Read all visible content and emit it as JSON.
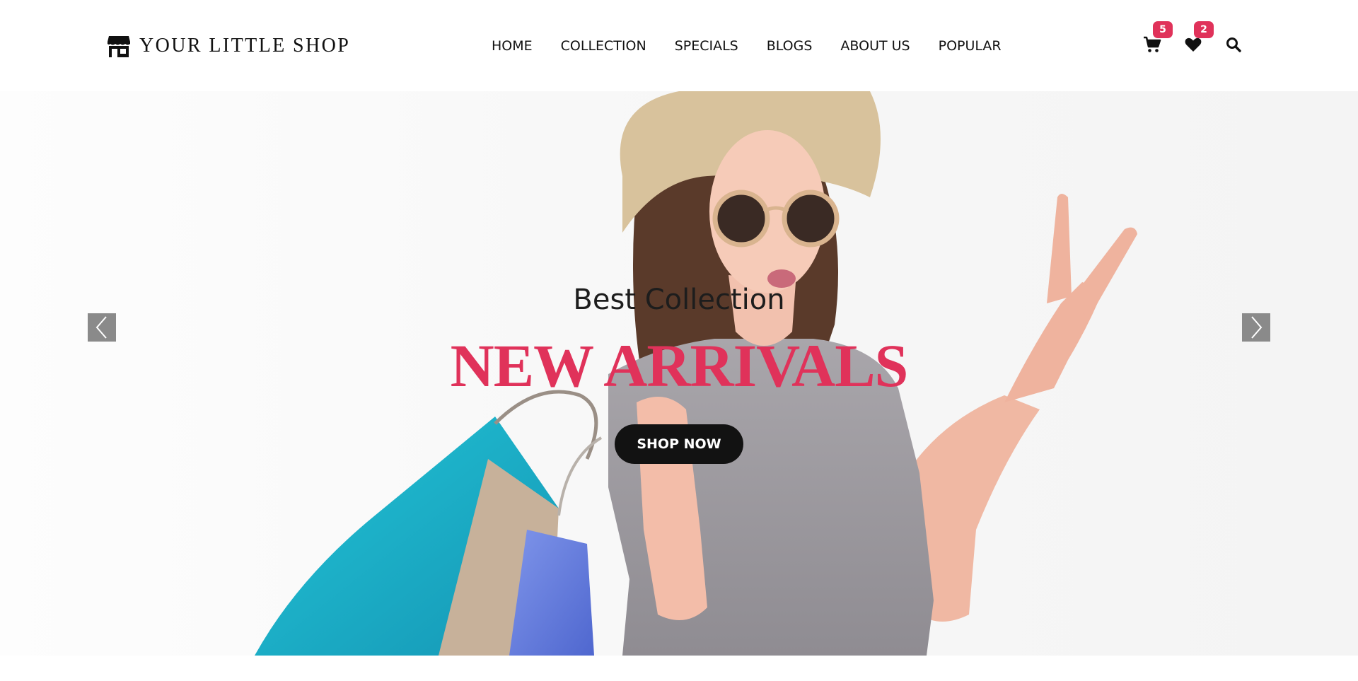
{
  "header": {
    "logo": {
      "text": "YOUR LITTLE SHOP",
      "icon": "storefront-icon"
    },
    "nav": [
      {
        "label": "HOME"
      },
      {
        "label": "COLLECTION"
      },
      {
        "label": "SPECIALS"
      },
      {
        "label": "BLOGS"
      },
      {
        "label": "ABOUT US"
      },
      {
        "label": "POPULAR"
      }
    ],
    "cart": {
      "icon": "cart-icon",
      "count": "5"
    },
    "wishlist": {
      "icon": "heart-icon",
      "count": "2"
    },
    "search": {
      "icon": "search-icon"
    }
  },
  "hero": {
    "subtitle": "Best Collection",
    "title": "NEW ARRIVALS",
    "button_label": "SHOP NOW",
    "prev_icon": "chevron-left-icon",
    "next_icon": "chevron-right-icon"
  },
  "colors": {
    "accent": "#e0325a",
    "button_bg": "#121212",
    "arrow_bg": "#8a8a8a",
    "text": "#111111"
  }
}
